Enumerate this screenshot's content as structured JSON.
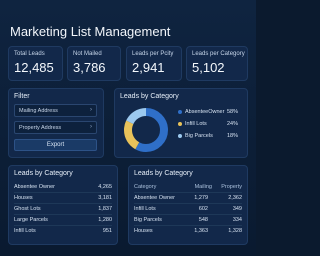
{
  "title": "Marketing List Management",
  "stats": [
    {
      "label": "Total Leads",
      "value": "12,485"
    },
    {
      "label": "Not Mailed",
      "value": "3,786"
    },
    {
      "label": "Leads per Pcity",
      "value": "2,941"
    },
    {
      "label": "Leads per Category",
      "value": "5,102"
    }
  ],
  "filter": {
    "title": "Filter",
    "fields": [
      "Mailing Address",
      "Property Address"
    ],
    "export_label": "Export"
  },
  "donut": {
    "title": "Leads by Category",
    "legend": [
      {
        "label": "AbsenteeOwner",
        "pct": "58%",
        "value": 58,
        "color": "#2f6fc8"
      },
      {
        "label": "Infill Lots",
        "pct": "24%",
        "value": 24,
        "color": "#e8c25a"
      },
      {
        "label": "Big Parcels",
        "pct": "18%",
        "value": 18,
        "color": "#9cc9ef"
      }
    ]
  },
  "category_list": {
    "title": "Leads by Category",
    "rows": [
      {
        "name": "Absentee Owner",
        "value": "4,265"
      },
      {
        "name": "Houses",
        "value": "3,181"
      },
      {
        "name": "Ghost Lots",
        "value": "1,837"
      },
      {
        "name": "Large Parcels",
        "value": "1,280"
      },
      {
        "name": "Infill Lots",
        "value": "951"
      }
    ]
  },
  "category_table": {
    "title": "Leads by Category",
    "headers": [
      "Category",
      "Mailing",
      "Property"
    ],
    "rows": [
      [
        "Absentee Owner",
        "1,279",
        "2,362"
      ],
      [
        "Infill Lots",
        "602",
        "349"
      ],
      [
        "Big Parcels",
        "548",
        "334"
      ],
      [
        "Houses",
        "1,363",
        "1,328"
      ]
    ]
  }
}
